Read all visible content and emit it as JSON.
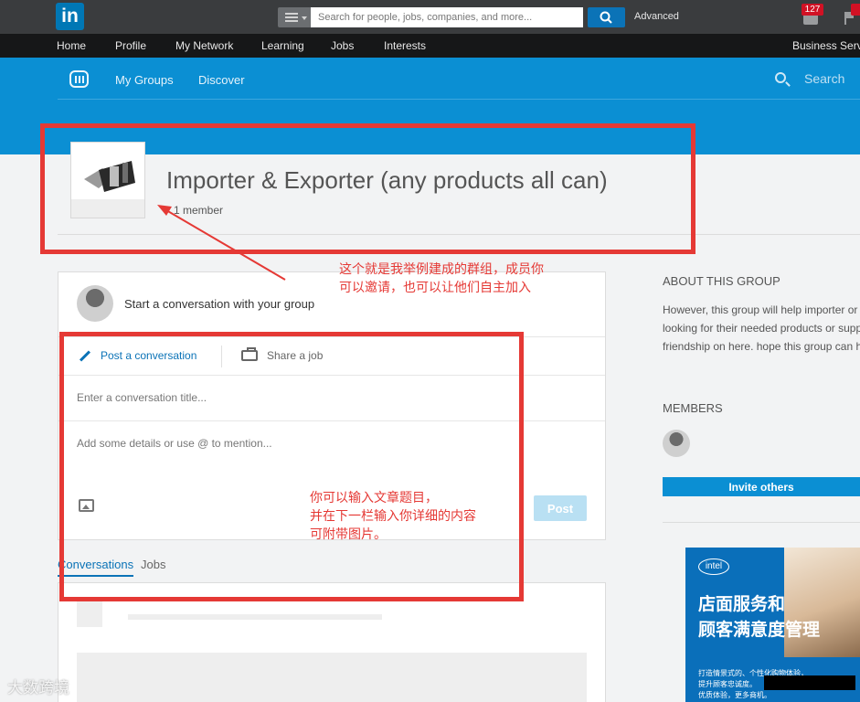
{
  "topbar": {
    "logo_text": "in",
    "search_placeholder": "Search for people, jobs, companies, and more...",
    "advanced_label": "Advanced",
    "message_count": "127"
  },
  "nav": {
    "items": [
      "Home",
      "Profile",
      "My Network",
      "Learning",
      "Jobs",
      "Interests"
    ],
    "right_item": "Business Servi"
  },
  "groups_header": {
    "tabs": [
      "My Groups",
      "Discover"
    ],
    "search_label": "Search"
  },
  "group": {
    "title": "Importer & Exporter (any products all can)",
    "member_text": "1 member"
  },
  "composer": {
    "prompt": "Start a conversation with your group",
    "tab_post": "Post a conversation",
    "tab_job": "Share a job",
    "title_placeholder": "Enter a conversation title...",
    "details_placeholder": "Add some details or use @ to mention...",
    "post_label": "Post"
  },
  "feed_tabs": [
    "Conversations",
    "Jobs"
  ],
  "sidebar": {
    "about_heading": "ABOUT THIS GROUP",
    "about_lines": [
      "However, this group will help importer or",
      "looking for their needed products or supp",
      "friendship on here. hope this group can h"
    ],
    "members_heading": "MEMBERS",
    "invite_label": "Invite others"
  },
  "ad": {
    "logo": "intel",
    "headline_lines": [
      "店面服务和",
      "顾客满意度管理"
    ],
    "small_lines": [
      "打造情景式的、个性化购物体验，",
      "提升顾客忠诚度。",
      "优质体验，更多商机。"
    ]
  },
  "annotations": {
    "note_group": [
      "这个就是我举例建成的群组，成员你",
      "可以邀请，也可以让他们自主加入"
    ],
    "note_post": [
      "你可以输入文章题目，",
      "并在下一栏输入你详细的内容",
      "可附带图片。"
    ]
  },
  "watermark": "大数跨境",
  "colors": {
    "linkedin_blue": "#0077b5",
    "groups_band": "#0b8fd3",
    "annotation_red": "#e53935"
  }
}
